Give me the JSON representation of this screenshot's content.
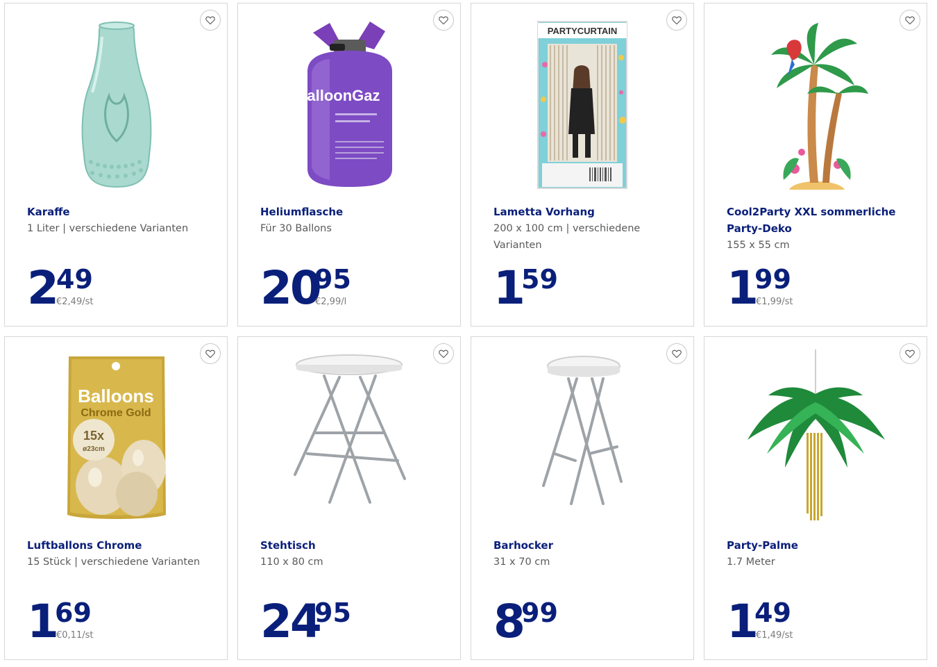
{
  "accent_color": "#0a1f7a",
  "favorite_icon": "heart-outline-icon",
  "products": [
    {
      "name": "Karaffe",
      "desc": [
        "1 Liter | verschiedene Varianten"
      ],
      "euros": "2",
      "cents": "49",
      "unit_price": "€2,49/st",
      "image": "glass-carafe-image"
    },
    {
      "name": "Heliumflasche",
      "desc": [
        "Für 30 Ballons"
      ],
      "euros": "20",
      "cents": "95",
      "unit_price": "€2,99/l",
      "image": "helium-tank-image",
      "image_label": "BalloonGaz"
    },
    {
      "name": "Lametta Vorhang",
      "desc": [
        "200 x 100 cm | verschiedene",
        "Varianten"
      ],
      "euros": "1",
      "cents": "59",
      "unit_price": "",
      "image": "party-curtain-image",
      "image_label": "PARTYCURTAIN"
    },
    {
      "name": "Cool2Party XXL sommerliche",
      "name2": "Party-Deko",
      "desc": [
        "155 x 55 cm"
      ],
      "euros": "1",
      "cents": "99",
      "unit_price": "€1,99/st",
      "image": "palm-tree-cutout-image"
    },
    {
      "name": "Luftballons Chrome",
      "desc": [
        "15 Stück | verschiedene Varianten"
      ],
      "euros": "1",
      "cents": "69",
      "unit_price": "€0,11/st",
      "image": "balloon-pack-image",
      "image_label": "Balloons",
      "image_label2": "Chrome Gold",
      "image_label3": "15x",
      "image_label4": "ø23cm"
    },
    {
      "name": "Stehtisch",
      "desc": [
        "110 x 80 cm"
      ],
      "euros": "24",
      "cents": "95",
      "unit_price": "",
      "image": "bar-table-image"
    },
    {
      "name": "Barhocker",
      "desc": [
        "31 x 70 cm"
      ],
      "euros": "8",
      "cents": "99",
      "unit_price": "",
      "image": "bar-stool-image"
    },
    {
      "name": "Party-Palme",
      "desc": [
        "1.7 Meter"
      ],
      "euros": "1",
      "cents": "49",
      "unit_price": "€1,49/st",
      "image": "hanging-palm-image"
    }
  ]
}
